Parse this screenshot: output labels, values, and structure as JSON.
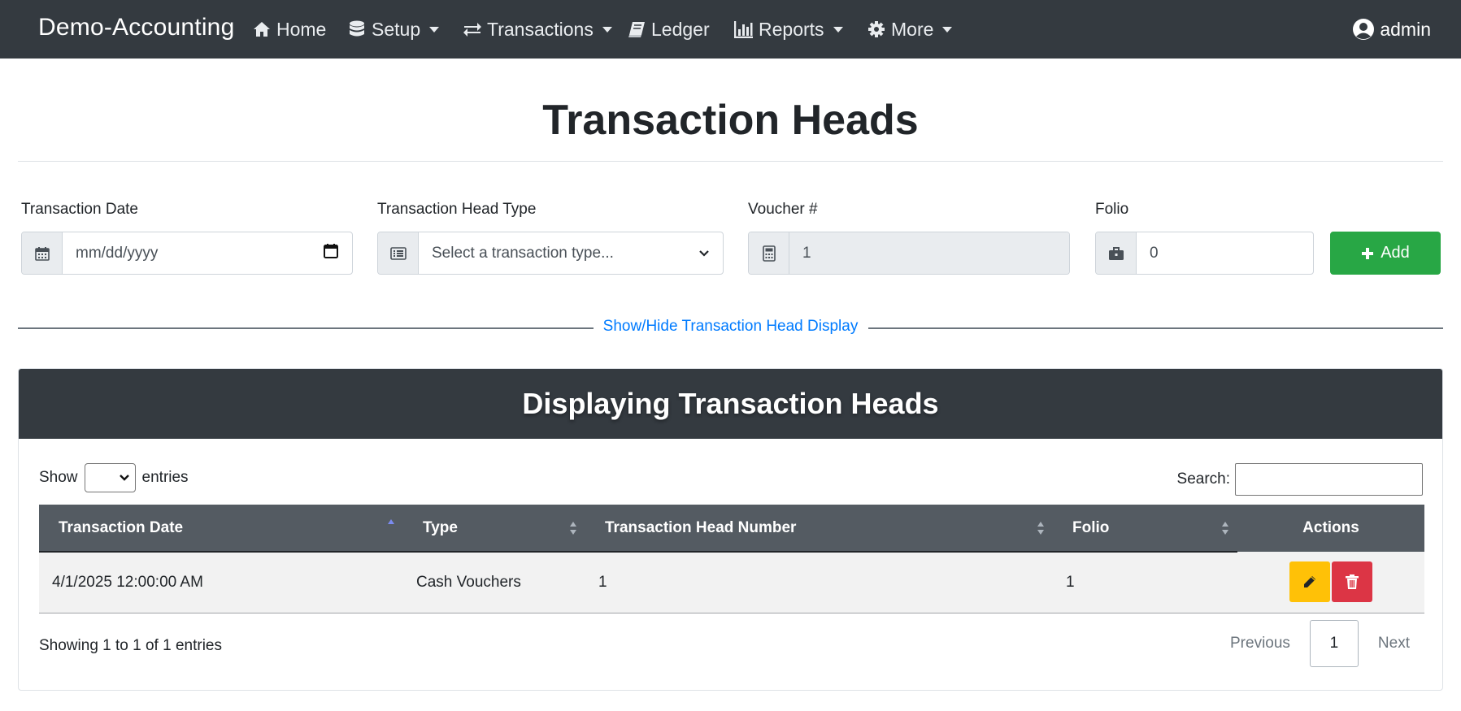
{
  "navbar": {
    "brand": "Demo-Accounting",
    "items": [
      {
        "label": "Home",
        "icon": "home-icon"
      },
      {
        "label": "Setup",
        "icon": "database-icon"
      },
      {
        "label": "Transactions",
        "icon": "exchange-icon"
      },
      {
        "label": "Ledger",
        "icon": "book-icon"
      },
      {
        "label": "Reports",
        "icon": "bar-chart-icon"
      },
      {
        "label": "More",
        "icon": "gear-icon"
      }
    ],
    "user": "admin"
  },
  "page": {
    "title": "Transaction Heads"
  },
  "form": {
    "date_label": "Transaction Date",
    "date_placeholder": "mm/dd/yyyy",
    "type_label": "Transaction Head Type",
    "type_placeholder": "Select a transaction type...",
    "voucher_label": "Voucher #",
    "voucher_value": "1",
    "folio_label": "Folio",
    "folio_value": "0",
    "add_label": "Add"
  },
  "toggle": {
    "label": "Show/Hide Transaction Head Display"
  },
  "card": {
    "title": "Displaying Transaction Heads",
    "show_label": "Show",
    "entries_label": "entries",
    "search_label": "Search:",
    "columns": [
      "Transaction Date",
      "Type",
      "Transaction Head Number",
      "Folio",
      "Actions"
    ],
    "rows": [
      {
        "date": "4/1/2025 12:00:00 AM",
        "type": "Cash Vouchers",
        "number": "1",
        "folio": "1"
      }
    ],
    "info": "Showing 1 to 1 of 1 entries",
    "pagination": {
      "previous": "Previous",
      "current": "1",
      "next": "Next"
    }
  },
  "colors": {
    "navbar_bg": "#343a40",
    "success": "#28a745",
    "warning": "#ffc107",
    "danger": "#dc3545",
    "link": "#007bff"
  }
}
